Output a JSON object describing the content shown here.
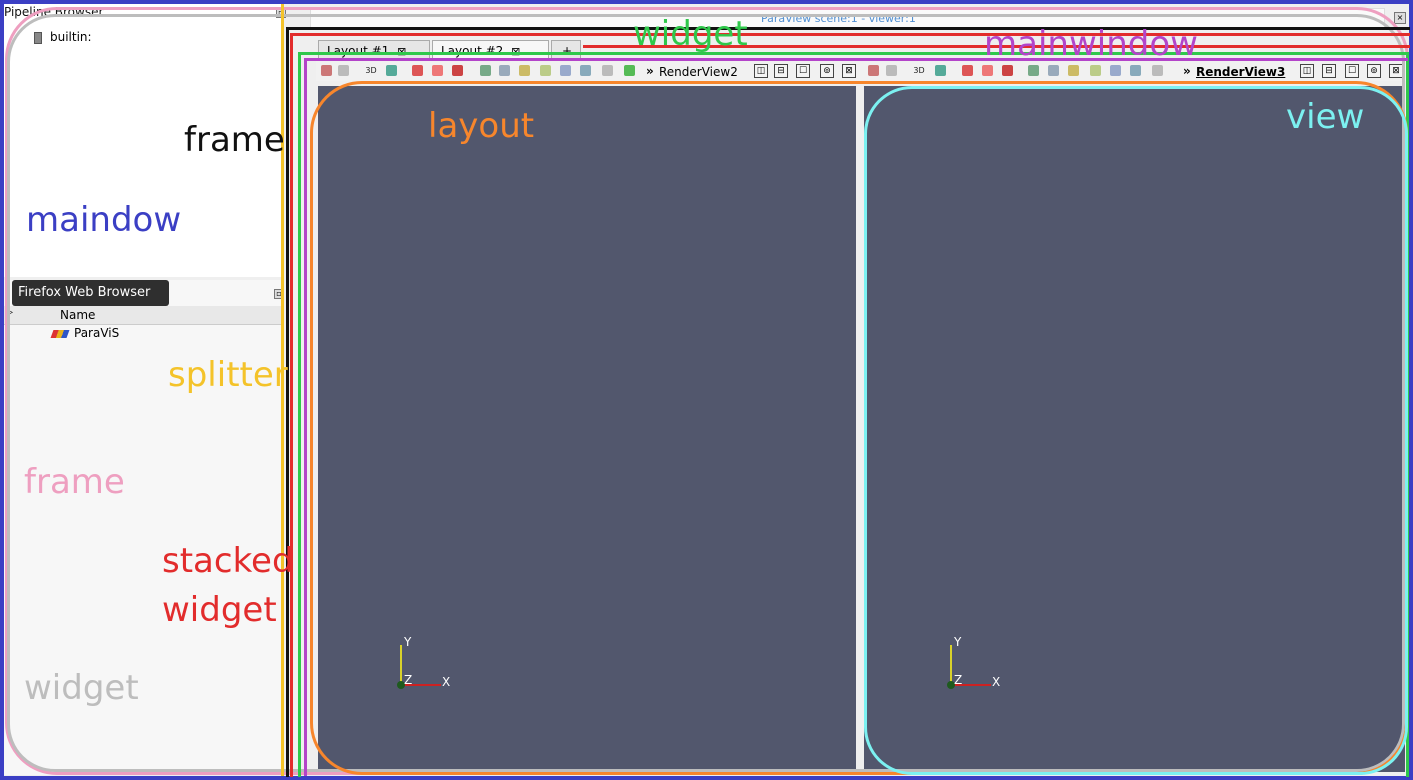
{
  "pipeline": {
    "title": "Pipeline Browser",
    "root": "builtin:"
  },
  "tooltip": "Firefox Web Browser",
  "tree": {
    "header": "Name",
    "item": "ParaViS"
  },
  "viewer_title": "ParaView scene:1 - viewer:1",
  "tabs": [
    {
      "label": "Layout #1",
      "close": "⊠"
    },
    {
      "label": "Layout #2",
      "close": "⊠"
    }
  ],
  "add_tab": "+",
  "views": [
    {
      "name": "RenderView2",
      "chevron": "»",
      "axes": {
        "x": "X",
        "y": "Y",
        "z": "Z"
      }
    },
    {
      "name": "RenderView3",
      "chevron": "»",
      "axes": {
        "x": "X",
        "y": "Y",
        "z": "Z"
      }
    }
  ],
  "toolbar": {
    "label_3d": "3D"
  },
  "view_buttons": [
    "◫",
    "⊟",
    "☐",
    "⊚",
    "⊠"
  ],
  "annotations": {
    "frame_1": "frame",
    "maindow": "maindow",
    "splitter": "splitter",
    "frame_2": "frame",
    "stacked": "stacked",
    "widget_2": "widget",
    "widget_1": "widget",
    "widget_3": "widget",
    "layout": "layout",
    "mainwindow": "mainwindow",
    "view": "view"
  },
  "colors": {
    "render_bg": "#52576d",
    "blue": "#3b3fc4",
    "pink": "#ee9fc0",
    "gray": "#bdbdbd",
    "yellow": "#f4c32a",
    "red": "#e22c2c",
    "green": "#2fc84b",
    "magenta": "#b344c9",
    "orange": "#f7862c",
    "cyan": "#7cf1f1"
  }
}
